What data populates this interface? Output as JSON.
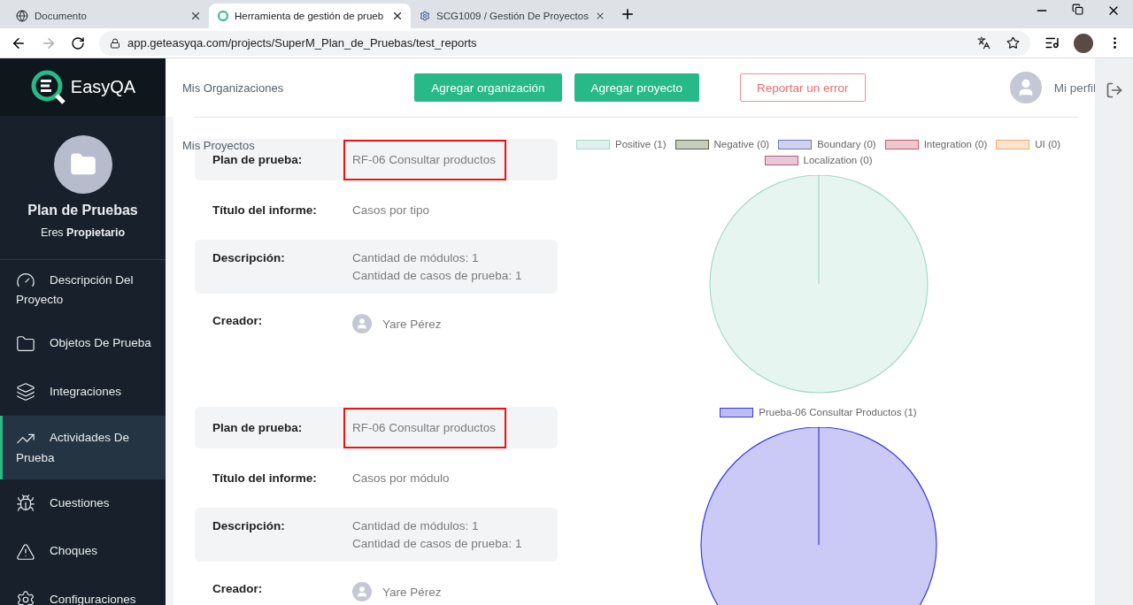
{
  "browser": {
    "tabs": [
      {
        "title": "Documento",
        "selected": false
      },
      {
        "title": "Herramienta de gestión de prueb",
        "selected": true
      },
      {
        "title": "SCG1009 / Gestión De Proyectos",
        "selected": false
      }
    ],
    "url": "app.geteasyqa.com/projects/SuperM_Plan_de_Pruebas/test_reports"
  },
  "logo": {
    "text": "EasyQA"
  },
  "header": {
    "link": "Mis Organizaciones",
    "buttons": [
      {
        "label": "Agregar organización",
        "kind": "primary"
      },
      {
        "label": "Agregar proyecto",
        "kind": "primary"
      },
      {
        "label": "Reportar un error",
        "kind": "outline"
      }
    ],
    "profile": "Mi perfil"
  },
  "sidebar": {
    "project": "Plan de Pruebas",
    "role": "Eres **Propietario**",
    "items": [
      {
        "label": "Descripción Del Proyecto",
        "selected": false
      },
      {
        "label": "Objetos De Prueba",
        "selected": false
      },
      {
        "label": "Integraciones",
        "selected": false
      },
      {
        "label": "Actividades De Prueba",
        "selected": true
      },
      {
        "label": "Cuestiones",
        "selected": false
      },
      {
        "label": "Choques",
        "selected": false
      },
      {
        "label": "Configuraciones",
        "selected": false
      }
    ]
  },
  "overlay_text": "Mis Proyectos",
  "reports": [
    {
      "fields": [
        {
          "label": "Plan de prueba:",
          "value": "RF-06 Consultar productos",
          "highlighted": true
        },
        {
          "label": "Título del informe:",
          "value": "Casos por tipo",
          "highlighted": false
        },
        {
          "label": "Descripción:",
          "lines": [
            "Cantidad de módulos: 1",
            "Cantidad de casos de prueba: 1"
          ]
        },
        {
          "label": "Creador:",
          "user": "Yare Pérez"
        }
      ],
      "chart_data": {
        "type": "pie",
        "categories": [
          "Positive (1)",
          "Negative (0)",
          "Boundary (0)",
          "Integration (0)",
          "UI (0)",
          "Localization (0)"
        ],
        "values": [
          1,
          0,
          0,
          0,
          0,
          0
        ],
        "colors": [
          "#a6d9cb",
          "#56663f",
          "#6e76c8",
          "#c9566c",
          "#f2ae6a",
          "#b35a84"
        ]
      }
    },
    {
      "fields": [
        {
          "label": "Plan de prueba:",
          "value": "RF-06 Consultar productos",
          "highlighted": true
        },
        {
          "label": "Título del informe:",
          "value": "Casos por módulo",
          "highlighted": false
        },
        {
          "label": "Descripción:",
          "lines": [
            "Cantidad de módulos: 1",
            "Cantidad de casos de prueba: 1"
          ]
        },
        {
          "label": "Creador:",
          "user": "Yare Pérez"
        }
      ],
      "chart_data": {
        "type": "pie",
        "categories": [
          "Prueba-06 Consultar Productos (1)"
        ],
        "values": [
          1
        ],
        "colors": [
          "#3c38dc"
        ]
      }
    }
  ]
}
